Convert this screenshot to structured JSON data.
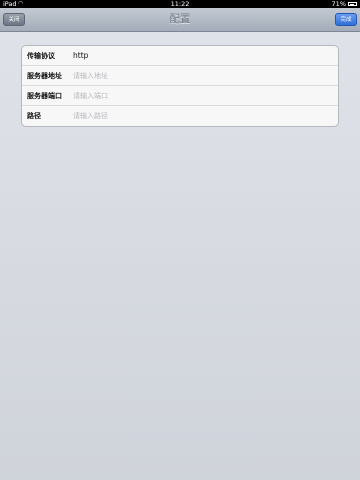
{
  "status_bar": {
    "carrier": "iPad",
    "time": "11:22",
    "battery": "71%"
  },
  "nav": {
    "title": "配置",
    "close_label": "关闭",
    "done_label": "完成"
  },
  "form": {
    "rows": [
      {
        "label": "传输协议",
        "value": "http",
        "placeholder": ""
      },
      {
        "label": "服务器地址",
        "value": "",
        "placeholder": "请输入地址"
      },
      {
        "label": "服务器端口",
        "value": "",
        "placeholder": "请输入端口"
      },
      {
        "label": "路径",
        "value": "",
        "placeholder": "请输入路径"
      }
    ]
  }
}
